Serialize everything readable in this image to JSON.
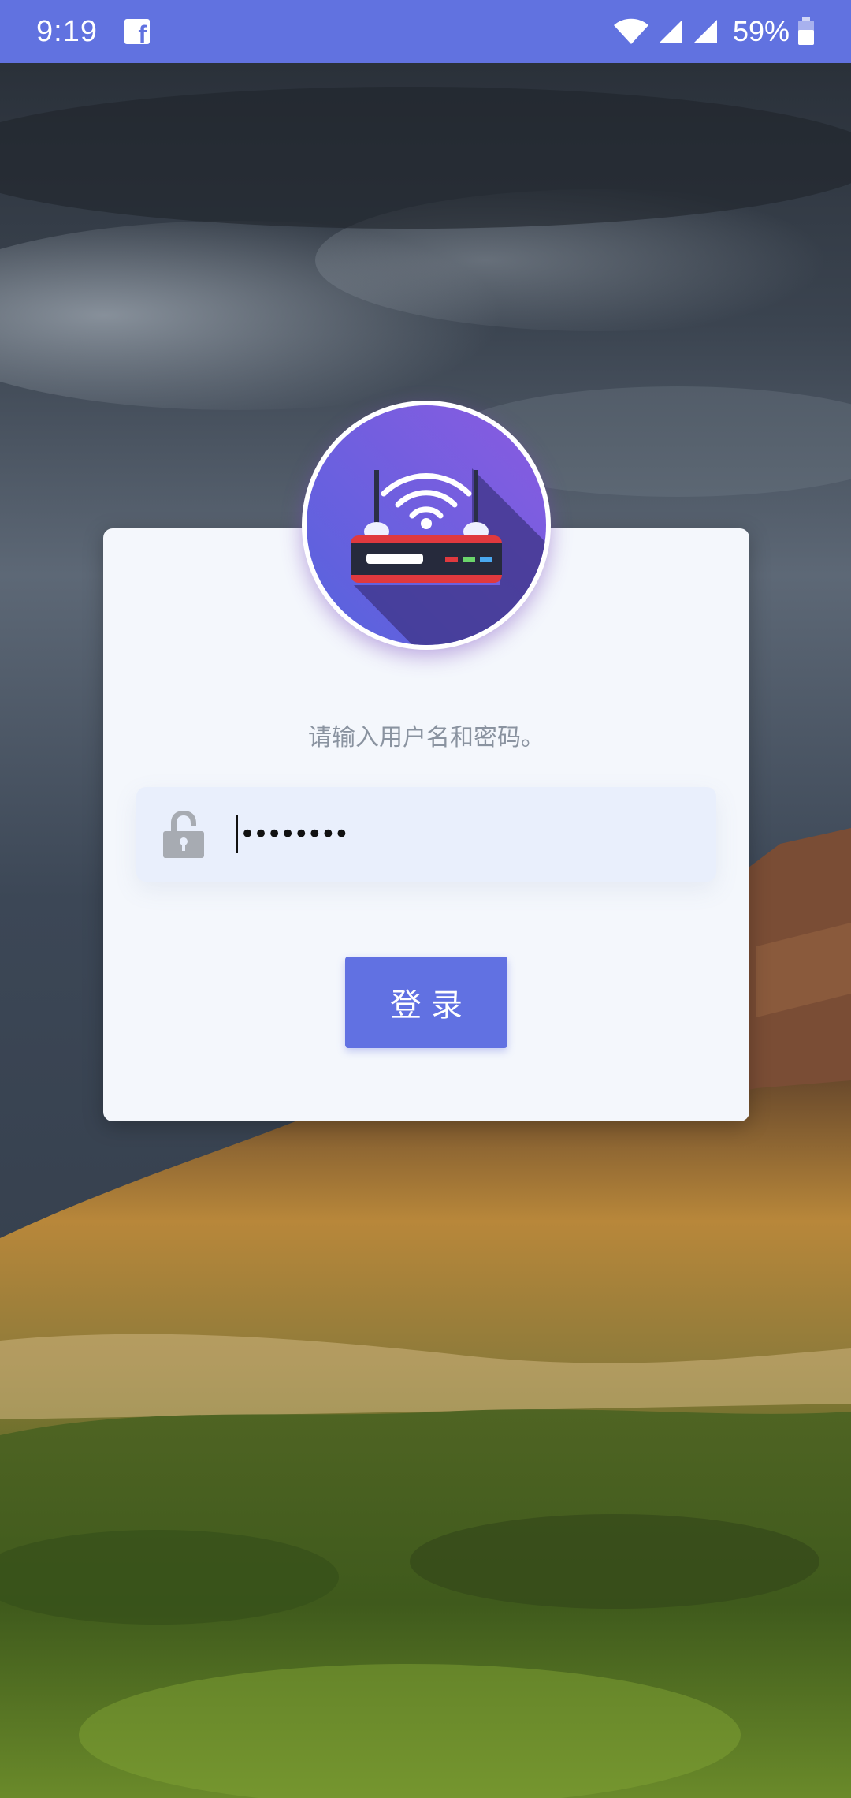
{
  "status_bar": {
    "time": "9:19",
    "notification_icon": "facebook-icon",
    "battery_percent": "59%",
    "icons": [
      "wifi-icon",
      "cell-signal-icon",
      "cell-signal-icon",
      "battery-icon"
    ],
    "color": "#6172e0"
  },
  "logo": {
    "icon": "router-icon",
    "gradient": [
      "#5b66e0",
      "#8a5be0"
    ]
  },
  "login": {
    "prompt": "请输入用户名和密码。",
    "password_mask": "••••••••",
    "lock_icon": "unlock-icon",
    "submit_label": "登录"
  },
  "colors": {
    "accent": "#6171e2",
    "card": "#f4f7fc",
    "field": "#e9effc"
  }
}
